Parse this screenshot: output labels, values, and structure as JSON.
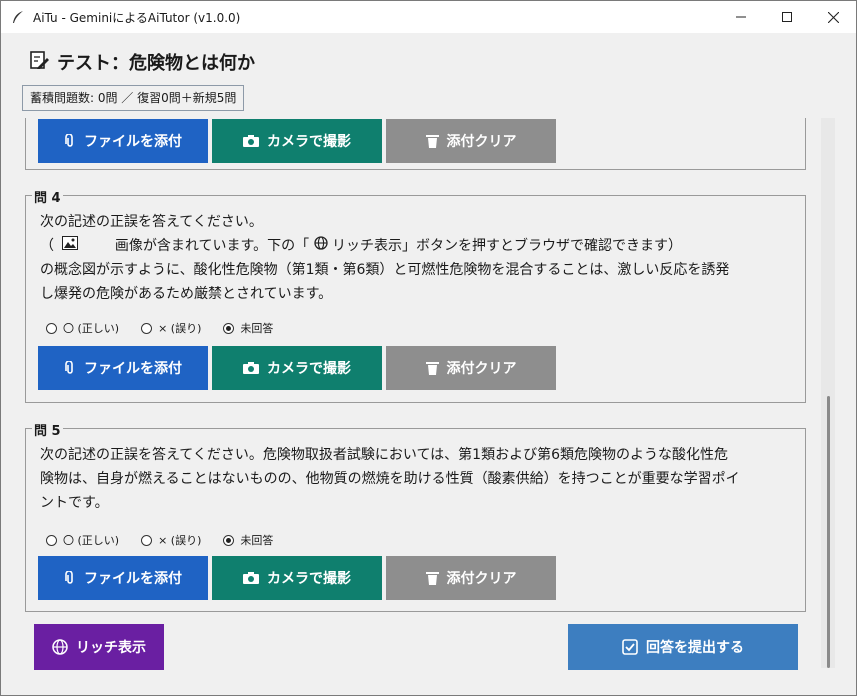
{
  "window": {
    "title": "AiTu - GeminiによるAiTutor (v1.0.0)",
    "controls": [
      "minimize-icon",
      "maximize-icon",
      "close-icon"
    ]
  },
  "header": {
    "title": "テスト：危険物とは何か",
    "stats": "蓄積問題数: 0問 ／ 復習0問＋新規5問"
  },
  "buttons": {
    "attach_file": "ファイルを添付",
    "camera": "カメラで撮影",
    "clear": "添付クリア",
    "rich_view": "リッチ表示",
    "submit": "回答を提出する"
  },
  "radio_options": {
    "true_label": "〇 (正しい)",
    "false_label": "× (誤り)",
    "unanswered_label": "未回答"
  },
  "questions": [
    {
      "label": "問 4",
      "line1": "次の記述の正誤を答えてください。",
      "line2_pre": "（",
      "line2_post": "　画像が含まれています。下の「",
      "line2_rich": " リッチ表示」ボタンを押すとブラウザで確認できます）",
      "line3": "の概念図が示すように、酸化性危険物（第1類・第6類）と可燃性危険物を混合することは、激しい反応を誘発",
      "line4": "し爆発の危険があるため厳禁とされています。",
      "selected": "未回答"
    },
    {
      "label": "問 5",
      "line1": "次の記述の正誤を答えてください。危険物取扱者試験においては、第1類および第6類危険物のような酸化性危",
      "line2": "険物は、自身が燃えることはないものの、他物質の燃焼を助ける性質（酸素供給）を持つことが重要な学習ポイ",
      "line3": "ントです。",
      "selected": "未回答"
    }
  ],
  "colors": {
    "blue": "#1f63c4",
    "green": "#0f7f6e",
    "gray": "#8e8e8e",
    "purple": "#6a1fa2",
    "submit": "#3d7ec0"
  }
}
